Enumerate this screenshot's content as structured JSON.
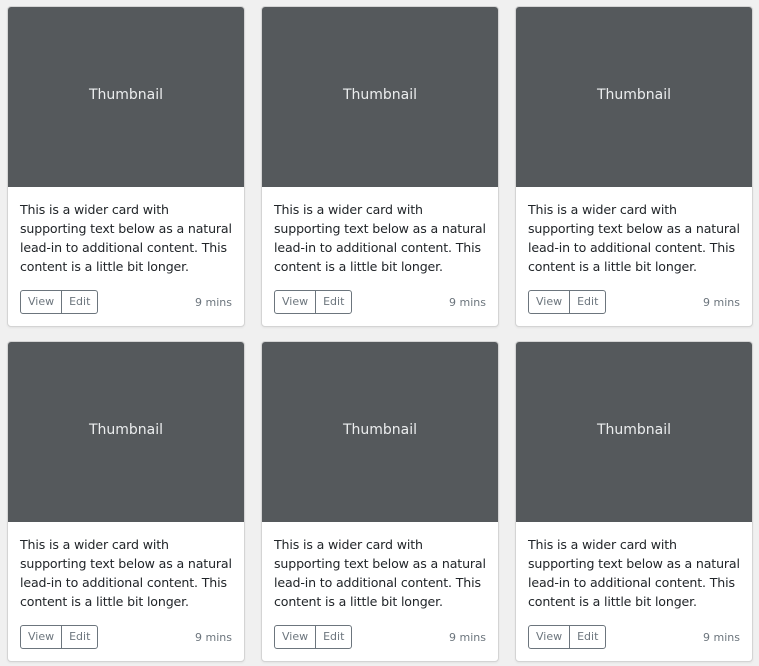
{
  "cards": [
    {
      "thumbnail": "Thumbnail",
      "text": "This is a wider card with supporting text below as a natural lead-in to additional content. This content is a little bit longer.",
      "view_label": "View",
      "edit_label": "Edit",
      "time": "9 mins"
    },
    {
      "thumbnail": "Thumbnail",
      "text": "This is a wider card with supporting text below as a natural lead-in to additional content. This content is a little bit longer.",
      "view_label": "View",
      "edit_label": "Edit",
      "time": "9 mins"
    },
    {
      "thumbnail": "Thumbnail",
      "text": "This is a wider card with supporting text below as a natural lead-in to additional content. This content is a little bit longer.",
      "view_label": "View",
      "edit_label": "Edit",
      "time": "9 mins"
    },
    {
      "thumbnail": "Thumbnail",
      "text": "This is a wider card with supporting text below as a natural lead-in to additional content. This content is a little bit longer.",
      "view_label": "View",
      "edit_label": "Edit",
      "time": "9 mins"
    },
    {
      "thumbnail": "Thumbnail",
      "text": "This is a wider card with supporting text below as a natural lead-in to additional content. This content is a little bit longer.",
      "view_label": "View",
      "edit_label": "Edit",
      "time": "9 mins"
    },
    {
      "thumbnail": "Thumbnail",
      "text": "This is a wider card with supporting text below as a natural lead-in to additional content. This content is a little bit longer.",
      "view_label": "View",
      "edit_label": "Edit",
      "time": "9 mins"
    }
  ],
  "colors": {
    "thumbnail_bg": "#55595c",
    "thumbnail_text": "#eceeef",
    "button_border": "#6c757d"
  }
}
